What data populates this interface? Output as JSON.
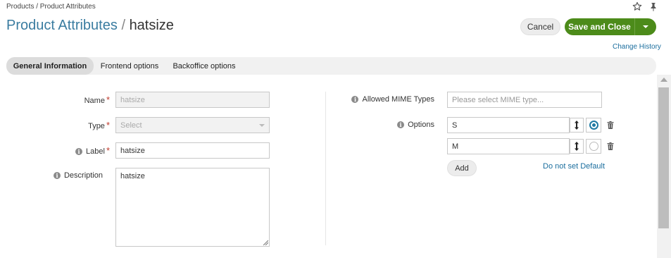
{
  "breadcrumb": "Products / Product Attributes",
  "header": {
    "entity": "Product Attributes",
    "separator": "/",
    "record": "hatsize",
    "cancel_label": "Cancel",
    "save_label": "Save and Close",
    "change_history": "Change History"
  },
  "tabs": [
    {
      "label": "General Information",
      "active": true
    },
    {
      "label": "Frontend options",
      "active": false
    },
    {
      "label": "Backoffice options",
      "active": false
    }
  ],
  "form": {
    "name": {
      "label": "Name",
      "value": "hatsize"
    },
    "type": {
      "label": "Type",
      "value": "Select"
    },
    "label": {
      "label": "Label",
      "value": "hatsize"
    },
    "description": {
      "label": "Description",
      "value": "hatsize"
    },
    "mime": {
      "label": "Allowed MIME Types",
      "placeholder": "Please select MIME type..."
    },
    "options": {
      "label": "Options",
      "items": [
        {
          "value": "S",
          "default": true
        },
        {
          "value": "M",
          "default": false
        }
      ],
      "add_label": "Add",
      "no_default_label": "Do not set Default"
    }
  },
  "colors": {
    "accent": "#3a7ca0",
    "primary_button": "#4c8b1a",
    "link": "#1b6e9e",
    "required": "#c0392b"
  },
  "icons": [
    "star-icon",
    "pin-icon",
    "info-icon",
    "sort-icon",
    "trash-icon",
    "chevron-down-icon"
  ]
}
